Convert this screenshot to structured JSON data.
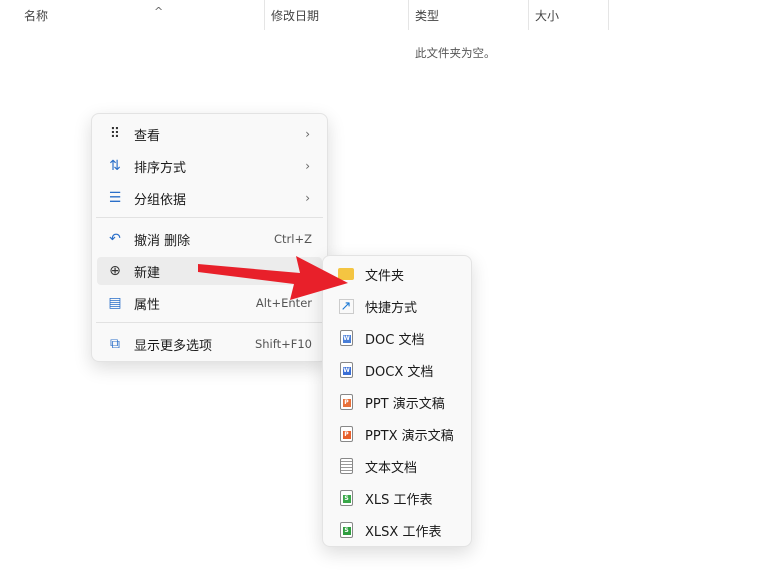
{
  "columns": [
    "名称",
    "修改日期",
    "类型",
    "大小"
  ],
  "empty_text": "此文件夹为空。",
  "context_menu": {
    "items": [
      {
        "label": "查看",
        "icon": "grid-icon",
        "submenu": true
      },
      {
        "label": "排序方式",
        "icon": "sort-icon",
        "submenu": true
      },
      {
        "label": "分组依据",
        "icon": "group-icon",
        "submenu": true
      },
      {
        "label": "撤消 删除",
        "icon": "undo-icon",
        "shortcut": "Ctrl+Z"
      },
      {
        "label": "新建",
        "icon": "plus-circle-icon"
      },
      {
        "label": "属性",
        "icon": "properties-icon",
        "shortcut": "Alt+Enter"
      },
      {
        "label": "显示更多选项",
        "icon": "more-options-icon",
        "shortcut": "Shift+F10"
      }
    ]
  },
  "new_submenu": {
    "items": [
      {
        "label": "文件夹",
        "icon": "folder-icon"
      },
      {
        "label": "快捷方式",
        "icon": "shortcut-icon"
      },
      {
        "label": "DOC 文档",
        "icon": "doc-icon",
        "color": "#4a7fd8"
      },
      {
        "label": "DOCX 文档",
        "icon": "docx-icon",
        "color": "#3b6fd6"
      },
      {
        "label": "PPT 演示文稿",
        "icon": "ppt-icon",
        "color": "#e8703a"
      },
      {
        "label": "PPTX 演示文稿",
        "icon": "pptx-icon",
        "color": "#e8602c"
      },
      {
        "label": "文本文档",
        "icon": "text-file-icon"
      },
      {
        "label": "XLS 工作表",
        "icon": "xls-icon",
        "color": "#3aa84a"
      },
      {
        "label": "XLSX 工作表",
        "icon": "xlsx-icon",
        "color": "#2f9e3f"
      }
    ]
  },
  "arrow_color": "#e8202a"
}
